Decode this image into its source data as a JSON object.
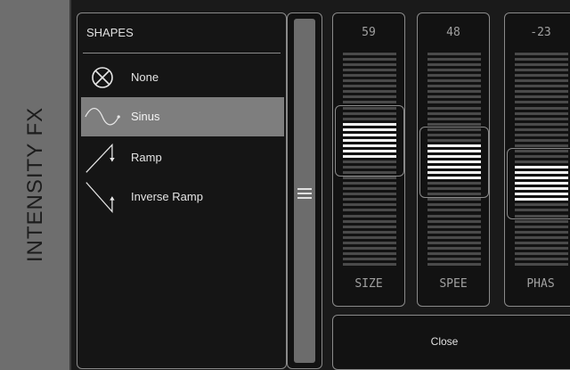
{
  "side": {
    "title": "INTENSITY FX"
  },
  "shapes": {
    "header": "SHAPES",
    "items": [
      {
        "label": "None",
        "icon": "none-circle-x-icon",
        "selected": false
      },
      {
        "label": "Sinus",
        "icon": "sine-wave-icon",
        "selected": true
      },
      {
        "label": "Ramp",
        "icon": "ramp-icon",
        "selected": false
      },
      {
        "label": "Inverse Ramp",
        "icon": "inverse-ramp-icon",
        "selected": false
      }
    ]
  },
  "faders": [
    {
      "name": "SIZE",
      "value": "59",
      "level": 0.59
    },
    {
      "name": "SPEE",
      "value": "48",
      "level": 0.48
    },
    {
      "name": "PHAS",
      "value": "-23",
      "level": 0.385
    }
  ],
  "close": {
    "label": "Close"
  },
  "colors": {
    "segment_on": "#f2f2f2",
    "segment_off": "#4a4a4a",
    "selected_row": "#7e7e7e",
    "side_strip": "#6e6e6e"
  }
}
